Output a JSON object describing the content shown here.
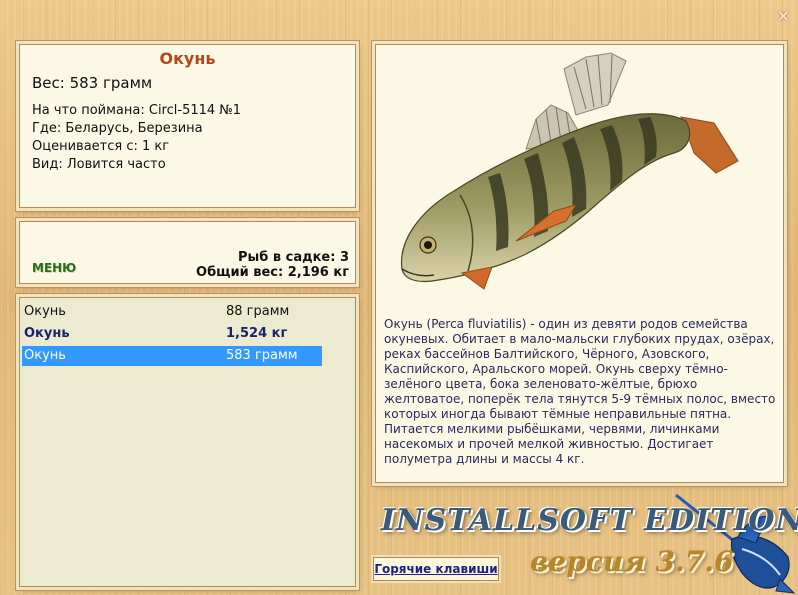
{
  "info": {
    "title": "Окунь",
    "weight": "Вес: 583 грамм",
    "caught_with": "На что поймана: Circl-5114 №1",
    "location": "Где: Беларусь, Березина",
    "valued_from": "Оценивается с: 1 кг",
    "kind": "Вид: Ловится часто"
  },
  "menu": {
    "button_label": "МЕНЮ",
    "fish_count": "Рыб в садке: 3",
    "total_weight": "Общий вес: 2,196 кг"
  },
  "catch_list": [
    {
      "name": "Окунь",
      "weight": "88 грамм"
    },
    {
      "name": "Окунь",
      "weight": "1,524 кг"
    },
    {
      "name": "Окунь",
      "weight": "583 грамм"
    }
  ],
  "description": "Окунь (Perca fluviatilis) - один из девяти родов семейства окуневых. Обитает в мало-мальски глубоких прудах, озёрах, реках бассейнов Балтийского, Чёрного, Азовского, Каспийского, Аральского морей. Окунь сверху тёмно-зелёного цвета, бока зеленовато-жёлтые, брюхо желтоватое, поперёк тела тянутся 5-9 тёмных полос, вместо которых иногда бывают тёмные неправильные пятна. Питается мелкими рыбёшками, червями, личинками насекомых и прочей мелкой живностью. Достигает полуметра длины и массы 4 кг.",
  "footer": {
    "hotkeys_label": "Горячие клавиши",
    "brand": "INSTALLSOFT EDITION",
    "version_label": "версия",
    "version_number": "3.7.6"
  },
  "window": {
    "close_symbol": "×"
  },
  "icons": [
    "perch-fish-image",
    "marlin-logo-icon",
    "close-icon"
  ],
  "colors": {
    "title": "#b3471a",
    "menu_button": "#2b6b1b",
    "selection": "#3399ff",
    "highlighted_row": "#1a2170"
  }
}
